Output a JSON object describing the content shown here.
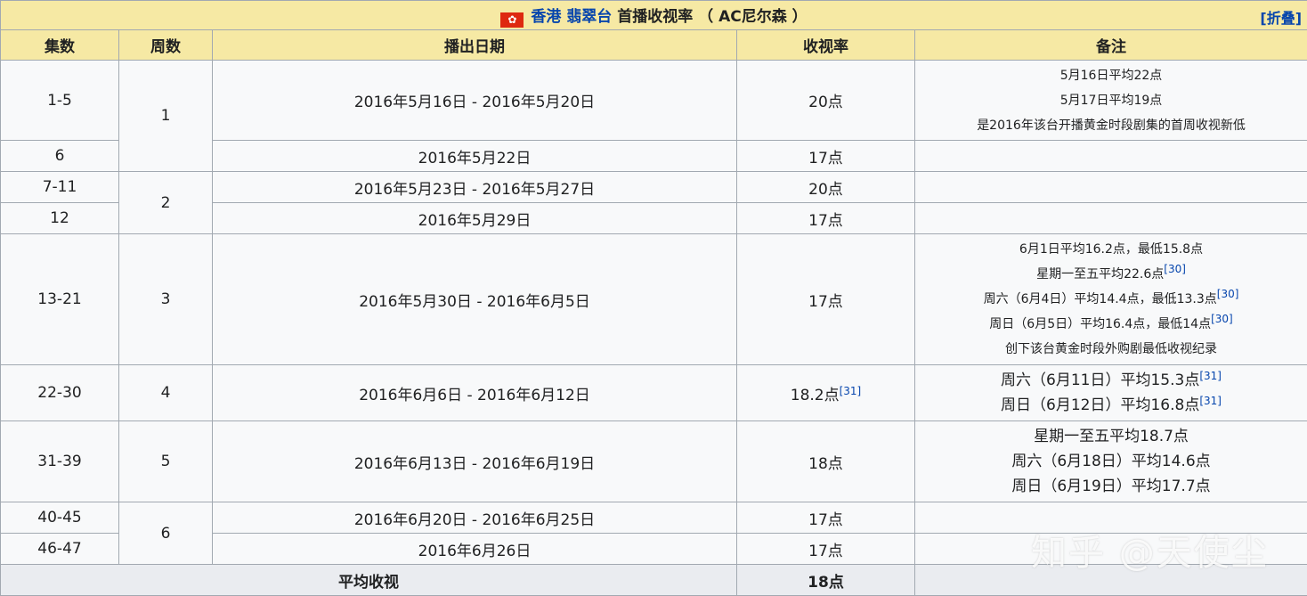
{
  "title": {
    "station_prefix": "香港",
    "station_link": "翡翠台",
    "text": "首播收视率 （ AC尼尔森 ）",
    "collapse_label": "[折叠]",
    "flag_symbol": "✿"
  },
  "columns": [
    "集数",
    "周数",
    "播出日期",
    "收视率",
    "备注"
  ],
  "rows": [
    {
      "episodes": "1-5",
      "week": "1",
      "date": "2016年5月16日 - 2016年5月20日",
      "rating": "20点",
      "notes": [
        "5月16日平均22点",
        "5月17日平均19点",
        "是2016年该台开播黄金时段剧集的首周收视新低"
      ]
    },
    {
      "episodes": "6",
      "date": "2016年5月22日",
      "rating": "17点",
      "notes": []
    },
    {
      "episodes": "7-11",
      "week": "2",
      "date": "2016年5月23日 - 2016年5月27日",
      "rating": "20点",
      "notes": []
    },
    {
      "episodes": "12",
      "date": "2016年5月29日",
      "rating": "17点",
      "notes": []
    },
    {
      "episodes": "13-21",
      "week": "3",
      "date": "2016年5月30日 - 2016年6月5日",
      "rating": "17点",
      "notes": [
        "6月1日平均16.2点，最低15.8点",
        "星期一至五平均22.6点",
        "周六（6月4日）平均14.4点，最低13.3点",
        "周日（6月5日）平均16.4点，最低14点",
        "创下该台黄金时段外购剧最低收视纪录"
      ],
      "note_refs": [
        "",
        "[30]",
        "[30]",
        "[30]",
        ""
      ]
    },
    {
      "episodes": "22-30",
      "week": "4",
      "date": "2016年6月6日 - 2016年6月12日",
      "rating": "18.2点",
      "rating_ref": "[31]",
      "notes": [
        "周六（6月11日）平均15.3点",
        "周日（6月12日）平均16.8点"
      ],
      "note_refs": [
        "[31]",
        "[31]"
      ]
    },
    {
      "episodes": "31-39",
      "week": "5",
      "date": "2016年6月13日 - 2016年6月19日",
      "rating": "18点",
      "notes": [
        "星期一至五平均18.7点",
        "周六（6月18日）平均14.6点",
        "周日（6月19日）平均17.7点"
      ]
    },
    {
      "episodes": "40-45",
      "week": "6",
      "date": "2016年6月20日 - 2016年6月25日",
      "rating": "17点",
      "notes": []
    },
    {
      "episodes": "46-47",
      "date": "2016年6月26日",
      "rating": "17点",
      "notes": []
    }
  ],
  "footer": {
    "label": "平均收视",
    "value": "18点"
  },
  "watermark": "知乎 @天使尘",
  "colors": {
    "header_bg": "#f6e9a4",
    "footer_bg": "#eaecf0",
    "body_bg": "#f8f9fa",
    "link": "#0645ad",
    "border": "#a2a9b1"
  }
}
